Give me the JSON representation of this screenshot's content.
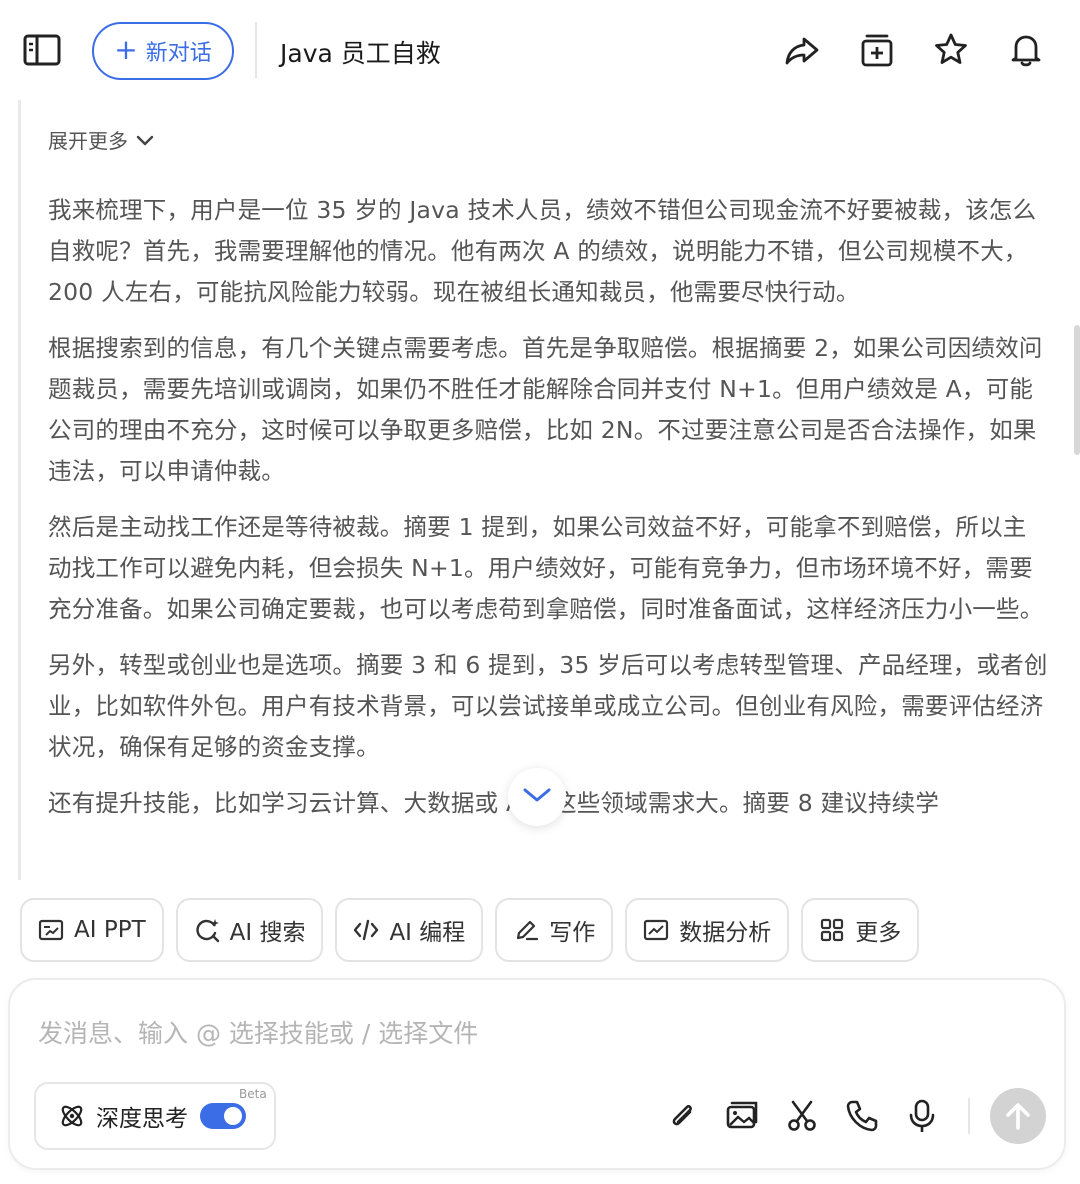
{
  "header": {
    "new_chat_label": "新对话",
    "title": "Java 员工自救",
    "icons": [
      "sidebar-toggle-icon",
      "share-icon",
      "add-to-collection-icon",
      "star-icon",
      "bell-icon"
    ]
  },
  "content": {
    "expand_label": "展开更多",
    "paragraphs": [
      "我来梳理下，用户是一位 35 岁的 Java 技术人员，绩效不错但公司现金流不好要被裁，该怎么自救呢？首先，我需要理解他的情况。他有两次 A 的绩效，说明能力不错，但公司规模不大，200 人左右，可能抗风险能力较弱。现在被组长通知裁员，他需要尽快行动。",
      "根据搜索到的信息，有几个关键点需要考虑。首先是争取赔偿。根据摘要 2，如果公司因绩效问题裁员，需要先培训或调岗，如果仍不胜任才能解除合同并支付 N+1。但用户绩效是 A，可能公司的理由不充分，这时候可以争取更多赔偿，比如 2N。不过要注意公司是否合法操作，如果违法，可以申请仲裁。",
      "然后是主动找工作还是等待被裁。摘要 1 提到，如果公司效益不好，可能拿不到赔偿，所以主动找工作可以避免内耗，但会损失 N+1。用户绩效好，可能有竞争力，但市场环境不好，需要充分准备。如果公司确定要裁，也可以考虑苟到拿赔偿，同时准备面试，这样经济压力小一些。",
      "另外，转型或创业也是选项。摘要 3 和 6 提到，35 岁后可以考虑转型管理、产品经理，或者创业，比如软件外包。用户有技术背景，可以尝试接单或成立公司。但创业有风险，需要评估经济状况，确保有足够的资金支撑。",
      "还有提升技能，比如学习云计算、大数据或 AI，这些领域需求大。摘要 8 建议持续学"
    ]
  },
  "skills": [
    {
      "label": "AI PPT",
      "icon": "ppt-icon"
    },
    {
      "label": "AI 搜索",
      "icon": "search-icon"
    },
    {
      "label": "AI 编程",
      "icon": "code-icon"
    },
    {
      "label": "写作",
      "icon": "pen-icon"
    },
    {
      "label": "数据分析",
      "icon": "chart-icon"
    },
    {
      "label": "更多",
      "icon": "grid-icon"
    }
  ],
  "input": {
    "placeholder": "发消息、输入 @ 选择技能或 / 选择文件",
    "deep_think_label": "深度思考",
    "beta_label": "Beta",
    "deep_think_on": true,
    "tools": [
      "attach-icon",
      "image-icon",
      "scissors-icon",
      "phone-icon",
      "microphone-icon"
    ]
  },
  "colors": {
    "accent": "#3b6de6",
    "text": "#555555",
    "placeholder": "#b5b5b5",
    "send_disabled": "#d3d3d3"
  }
}
